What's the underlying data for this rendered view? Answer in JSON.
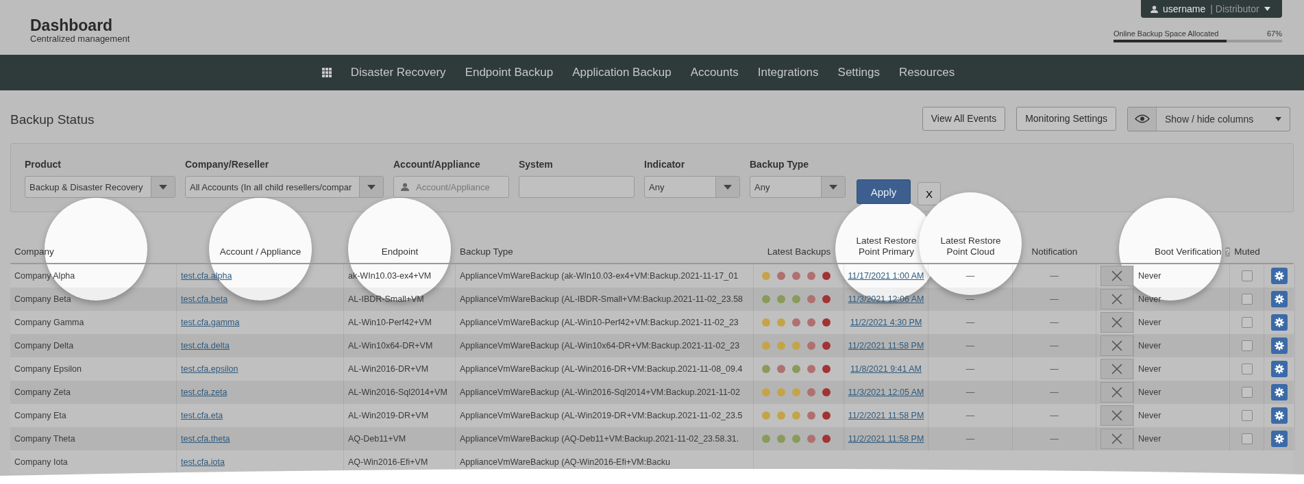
{
  "header": {
    "title": "Dashboard",
    "subtitle": "Centralized management",
    "user": {
      "name": "username",
      "separator": "|",
      "role": "Distributor"
    },
    "storage": {
      "label": "Online Backup Space Allocated",
      "reading": "67%",
      "level": 0.67
    }
  },
  "nav": {
    "items": [
      "Disaster Recovery",
      "Endpoint Backup",
      "Application Backup",
      "Accounts",
      "Integrations",
      "Settings",
      "Resources"
    ]
  },
  "page": {
    "title": "Backup Status",
    "actions": [
      "View All Events",
      "Monitoring Settings"
    ],
    "columns_toggle": "Show / hide columns"
  },
  "filters": [
    {
      "kind": "select",
      "label": "Product",
      "value": "Backup & Disaster Recovery"
    },
    {
      "kind": "select",
      "label": "Company/Reseller",
      "value": "All Accounts (In all child resellers/compar"
    },
    {
      "kind": "account",
      "label": "Account/Appliance",
      "placeholder": "Account/Appliance"
    },
    {
      "kind": "text",
      "label": "System"
    },
    {
      "kind": "select",
      "label": "Indicator",
      "value": "Any"
    },
    {
      "kind": "select",
      "label": "Backup Type",
      "value": "Any"
    }
  ],
  "filter_buttons": {
    "apply": "Apply",
    "clear": "X"
  },
  "table": {
    "columns": [
      "Company",
      "Account / Appliance",
      "Endpoint",
      "Backup Type",
      "Latest Backups",
      "Latest Restore Point Primary",
      "Latest Restore Point Cloud",
      "Notification",
      "Boot Verification",
      "Muted"
    ],
    "help": "?",
    "rows": [
      {
        "company": "Company Alpha",
        "account": "test.cfa.alpha",
        "endpoint": "ak-WIn10.03-ex4+VM",
        "backup_type": "ApplianceVmWareBackup (ak-WIn10.03-ex4+VM:Backup.2021-11-17_01",
        "backups": [
          {
            "color": "#c4a448"
          },
          {
            "color": "#b07070"
          },
          {
            "color": "#b07070"
          },
          {
            "color": "#b07070"
          },
          {
            "color": "#a33333"
          }
        ],
        "primary": "11/17/2021 1:00 AM",
        "cloud": "—",
        "notification": "—",
        "boot": "Never",
        "muted": false
      },
      {
        "company": "Company Beta",
        "account": "test.cfa.beta",
        "endpoint": "AL-IBDR-Small+VM",
        "backup_type": "ApplianceVmWareBackup (AL-IBDR-Small+VM:Backup.2021-11-02_23.58",
        "backups": [
          {
            "color": "#8a9a5a"
          },
          {
            "color": "#8a9a5a"
          },
          {
            "color": "#8a9a5a"
          },
          {
            "color": "#b07070"
          },
          {
            "color": "#a33333"
          }
        ],
        "primary": "11/3/2021 12:06 AM",
        "cloud": "—",
        "notification": "—",
        "boot": "Never",
        "muted": false
      },
      {
        "company": "Company Gamma",
        "account": "test.cfa.gamma",
        "endpoint": "AL-Win10-Perf42+VM",
        "backup_type": "ApplianceVmWareBackup (AL-Win10-Perf42+VM:Backup.2021-11-02_23",
        "backups": [
          {
            "color": "#c4a448"
          },
          {
            "color": "#c4a448"
          },
          {
            "color": "#b07070"
          },
          {
            "color": "#b07070"
          },
          {
            "color": "#a33333"
          }
        ],
        "primary": "11/2/2021 4:30 PM",
        "cloud": "—",
        "notification": "—",
        "boot": "Never",
        "muted": false
      },
      {
        "company": "Company Delta",
        "account": "test.cfa.delta",
        "endpoint": "AL-Win10x64-DR+VM",
        "backup_type": "ApplianceVmWareBackup (AL-Win10x64-DR+VM:Backup.2021-11-02_23",
        "backups": [
          {
            "color": "#c4a448"
          },
          {
            "color": "#c4a448"
          },
          {
            "color": "#c4a448"
          },
          {
            "color": "#b07070"
          },
          {
            "color": "#a33333"
          }
        ],
        "primary": "11/2/2021 11:58 PM",
        "cloud": "—",
        "notification": "—",
        "boot": "Never",
        "muted": false
      },
      {
        "company": "Company Epsilon",
        "account": "test.cfa.epsilon",
        "endpoint": "AL-Win2016-DR+VM",
        "backup_type": "ApplianceVmWareBackup (AL-Win2016-DR+VM:Backup.2021-11-08_09.4",
        "backups": [
          {
            "color": "#8a9a5a"
          },
          {
            "color": "#b07070"
          },
          {
            "color": "#8a9a5a"
          },
          {
            "color": "#b07070"
          },
          {
            "color": "#a33333"
          }
        ],
        "primary": "11/8/2021 9:41 AM",
        "cloud": "—",
        "notification": "—",
        "boot": "Never",
        "muted": false
      },
      {
        "company": "Company Zeta",
        "account": "test.cfa.zeta",
        "endpoint": "AL-Win2016-Sql2014+VM",
        "backup_type": "ApplianceVmWareBackup (AL-Win2016-Sql2014+VM:Backup.2021-11-02",
        "backups": [
          {
            "color": "#c4a448"
          },
          {
            "color": "#c4a448"
          },
          {
            "color": "#c4a448"
          },
          {
            "color": "#b07070"
          },
          {
            "color": "#a33333"
          }
        ],
        "primary": "11/3/2021 12:05 AM",
        "cloud": "—",
        "notification": "—",
        "boot": "Never",
        "muted": false
      },
      {
        "company": "Company Eta",
        "account": "test.cfa.eta",
        "endpoint": "AL-Win2019-DR+VM",
        "backup_type": "ApplianceVmWareBackup (AL-Win2019-DR+VM:Backup.2021-11-02_23.5",
        "backups": [
          {
            "color": "#c4a448"
          },
          {
            "color": "#c4a448"
          },
          {
            "color": "#c4a448"
          },
          {
            "color": "#b07070"
          },
          {
            "color": "#a33333"
          }
        ],
        "primary": "11/2/2021 11:58 PM",
        "cloud": "—",
        "notification": "—",
        "boot": "Never",
        "muted": false
      },
      {
        "company": "Company Theta",
        "account": "test.cfa.theta",
        "endpoint": "AQ-Deb11+VM",
        "backup_type": "ApplianceVmWareBackup (AQ-Deb11+VM:Backup.2021-11-02_23.58.31.",
        "backups": [
          {
            "color": "#8a9a5a"
          },
          {
            "color": "#8a9a5a"
          },
          {
            "color": "#8a9a5a"
          },
          {
            "color": "#b07070"
          },
          {
            "color": "#a33333"
          }
        ],
        "primary": "11/2/2021 11:58 PM",
        "cloud": "—",
        "notification": "—",
        "boot": "Never",
        "muted": false
      },
      {
        "company": "Company Iota",
        "account": "test.cfa.iota",
        "endpoint": "AQ-Win2016-Efi+VM",
        "backup_type": "ApplianceVmWareBackup (AQ-Win2016-Efi+VM:Backu"
      }
    ]
  }
}
